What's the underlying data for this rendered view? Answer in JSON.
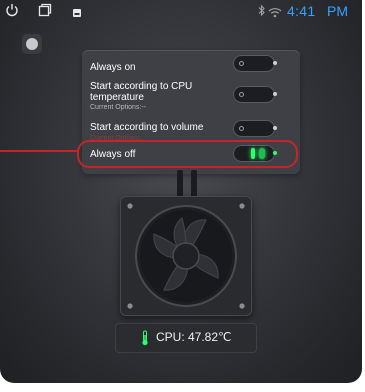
{
  "status_bar": {
    "time": "4:41",
    "ampm": "PM",
    "icons": [
      "power-icon",
      "window-icon",
      "photo-icon",
      "bluetooth-icon",
      "wifi-icon"
    ],
    "accent": "#3aa0ff"
  },
  "options_panel": {
    "items": [
      {
        "label": "Always on",
        "sub": "",
        "state": "off"
      },
      {
        "label": "Start according to CPU temperature",
        "sub": "Current Options:--",
        "state": "off"
      },
      {
        "label": "Start according to volume",
        "sub": "Current Options:",
        "state": "off"
      },
      {
        "label": "Always off",
        "sub": "",
        "state": "on"
      }
    ]
  },
  "cpu_readout": {
    "label": "CPU: 47.82℃",
    "icon": "thermometer-icon"
  },
  "colors": {
    "highlight": "#c4252a",
    "led_on": "#2cff6a"
  }
}
